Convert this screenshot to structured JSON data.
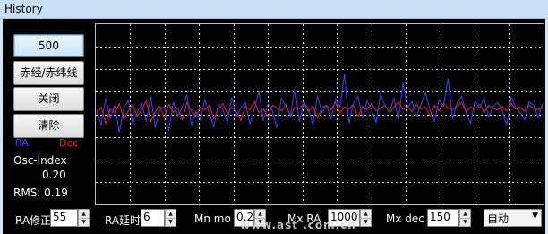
{
  "window": {
    "title": "History"
  },
  "buttons": {
    "scale": "500",
    "ra_dec": "赤经/赤纬线",
    "close": "关闭",
    "clear": "清除"
  },
  "legend": {
    "ra": "RA",
    "dec": "Dec"
  },
  "stats": {
    "osc_label": "Osc-Index",
    "osc_value": "0.20",
    "rms": "RMS: 0.19"
  },
  "controls": {
    "ra_fix_label": "RA修正",
    "ra_fix_value": "55",
    "ra_delay_label": "RA延时",
    "ra_delay_value": "6",
    "mn_mo_label": "Mn mo",
    "mn_mo_value": "0.2",
    "mx_ra_label": "Mx RA",
    "mx_ra_value": "1000",
    "mx_dec_label": "Mx dec",
    "mx_dec_value": "150",
    "mode_value": "自动"
  },
  "watermark": "www.ast   .com.cn",
  "chart_data": {
    "type": "line",
    "grid": true,
    "series": [
      {
        "name": "RA",
        "color": "#4040ff",
        "values": [
          0.05,
          -0.12,
          0.18,
          -0.05,
          0.1,
          -0.2,
          0.07,
          0.15,
          -0.1,
          0.02,
          0.12,
          -0.08,
          0.2,
          -0.15,
          0.05,
          0.09,
          -0.18,
          0.14,
          -0.02,
          0.08,
          0.22,
          -0.12,
          0.03,
          -0.06,
          0.16,
          0.01,
          -0.14,
          0.11,
          0.05,
          -0.09,
          0.19,
          -0.03,
          0.07,
          0.13,
          -0.11,
          0.06,
          0.25,
          -0.07,
          0.12,
          0.04,
          -0.15,
          0.18,
          0.09,
          -0.02,
          0.3,
          -0.08,
          0.14,
          0.06,
          -0.12,
          0.21,
          0.02,
          0.1,
          -0.05,
          0.17,
          0.08,
          0.45,
          -0.1,
          0.12,
          0.2,
          -0.04,
          0.15,
          0.05,
          -0.09,
          0.22,
          0.1,
          0.03,
          0.18,
          -0.06,
          0.35,
          0.08,
          0.14,
          -0.02,
          0.11,
          0.24,
          0.05,
          -0.08,
          0.16,
          0.09,
          0.4,
          -0.05,
          0.12,
          0.2,
          0.02,
          -0.1,
          0.15,
          0.07,
          0.18,
          -0.03,
          0.09,
          0.13,
          0.05,
          -0.12,
          0.19,
          0.08,
          0.02,
          -0.06,
          0.14,
          0.1,
          -0.04,
          0.12
        ]
      },
      {
        "name": "Dec",
        "color": "#ff2020",
        "values": [
          0.0,
          0.08,
          -0.1,
          0.06,
          0.02,
          0.12,
          -0.06,
          0.04,
          0.1,
          -0.02,
          0.05,
          0.15,
          -0.08,
          0.03,
          0.09,
          -0.04,
          0.11,
          0.02,
          0.07,
          -0.06,
          0.13,
          0.04,
          -0.02,
          0.08,
          0.05,
          0.1,
          -0.05,
          0.06,
          0.12,
          0.01,
          0.08,
          0.03,
          -0.07,
          0.09,
          0.05,
          0.14,
          0.02,
          0.06,
          -0.03,
          0.1,
          0.07,
          0.04,
          0.11,
          -0.02,
          0.08,
          0.06,
          0.12,
          0.03,
          0.09,
          -0.04,
          0.07,
          0.1,
          0.05,
          0.13,
          0.02,
          0.08,
          0.06,
          0.11,
          -0.03,
          0.09,
          0.05,
          0.12,
          0.04,
          0.07,
          0.1,
          0.02,
          0.08,
          0.14,
          0.05,
          0.09,
          0.03,
          0.11,
          0.06,
          0.08,
          -0.02,
          0.1,
          0.04,
          0.12,
          0.07,
          0.05,
          0.09,
          0.13,
          0.03,
          0.08,
          0.06,
          0.11,
          0.02,
          0.1,
          0.07,
          0.05,
          0.09,
          0.04,
          0.12,
          0.06,
          0.08,
          0.03,
          0.1,
          0.07,
          0.05,
          0.09
        ]
      }
    ],
    "ylim": [
      -1.0,
      1.0
    ]
  }
}
